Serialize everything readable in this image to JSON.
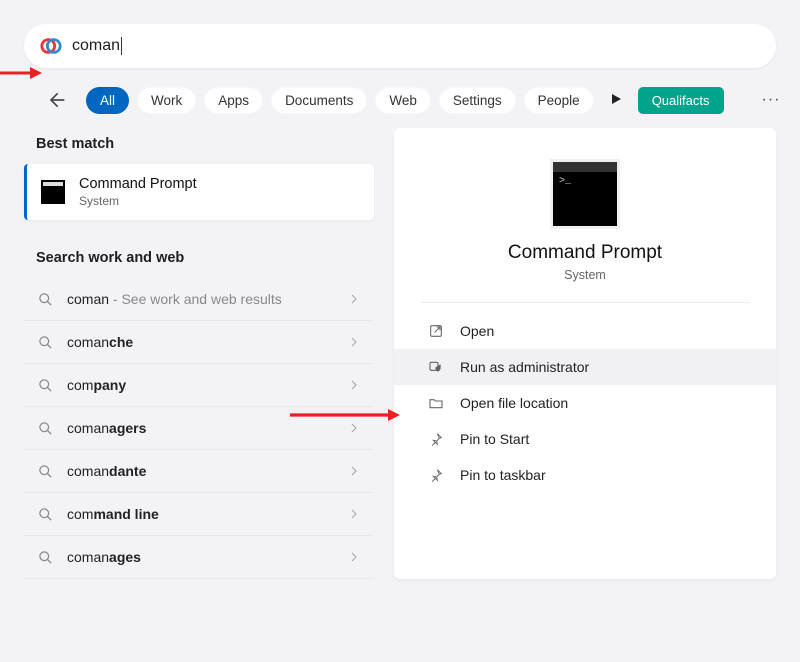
{
  "search": {
    "query": "coman"
  },
  "tabs": [
    {
      "label": "All",
      "active": true
    },
    {
      "label": "Work"
    },
    {
      "label": "Apps"
    },
    {
      "label": "Documents"
    },
    {
      "label": "Web"
    },
    {
      "label": "Settings"
    },
    {
      "label": "People"
    }
  ],
  "qual_button": "Qualifacts",
  "left": {
    "best_match_header": "Best match",
    "best_match": {
      "title": "Command Prompt",
      "subtitle": "System"
    },
    "search_header": "Search work and web",
    "suggestions": [
      {
        "prefix": "coman",
        "bold": "",
        "hint": " - See work and web results"
      },
      {
        "prefix": "coman",
        "bold": "che",
        "hint": ""
      },
      {
        "prefix": "com",
        "bold": "pany",
        "hint": ""
      },
      {
        "prefix": "coman",
        "bold": "agers",
        "hint": ""
      },
      {
        "prefix": "coman",
        "bold": "dante",
        "hint": ""
      },
      {
        "prefix": "com",
        "bold": "mand line",
        "hint": ""
      },
      {
        "prefix": "coman",
        "bold": "ages",
        "hint": ""
      }
    ]
  },
  "right": {
    "title": "Command Prompt",
    "subtitle": "System",
    "actions": [
      {
        "icon": "open-icon",
        "label": "Open"
      },
      {
        "icon": "shield-icon",
        "label": "Run as administrator",
        "highlight": true
      },
      {
        "icon": "folder-icon",
        "label": "Open file location"
      },
      {
        "icon": "pin-icon",
        "label": "Pin to Start"
      },
      {
        "icon": "pin-icon",
        "label": "Pin to taskbar"
      }
    ]
  }
}
